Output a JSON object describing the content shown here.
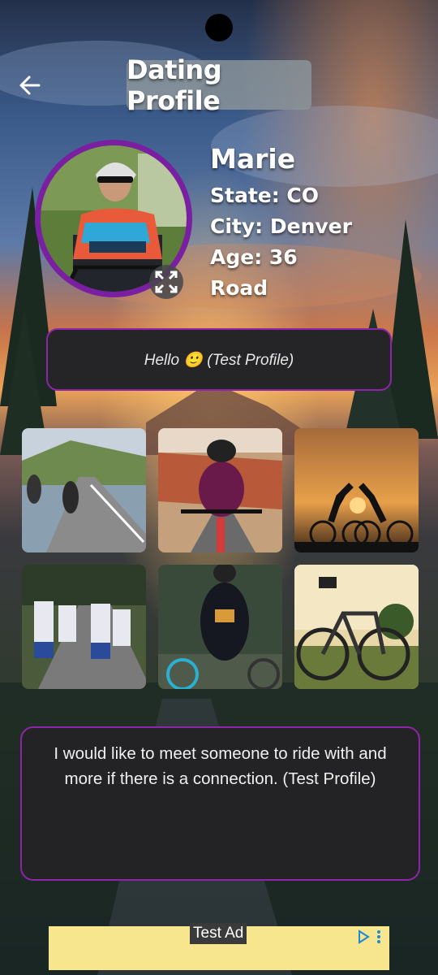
{
  "header": {
    "title": "Dating Profile",
    "back_icon": "arrow-left-icon"
  },
  "profile": {
    "name": "Marie",
    "state": "State: CO",
    "city": "City: Denver",
    "age": "Age: 36",
    "type": "Road",
    "greeting": "Hello 🙂 (Test Profile)",
    "bio": "I would like to meet someone to ride with and more if there is a connection. (Test Profile)"
  },
  "photos": [
    "photo-1",
    "photo-2",
    "photo-3",
    "photo-4",
    "photo-5",
    "photo-6"
  ],
  "ad": {
    "label": "Test Ad"
  },
  "colors": {
    "accent_border": "#8e24aa",
    "ad_background": "#f8e68f"
  }
}
